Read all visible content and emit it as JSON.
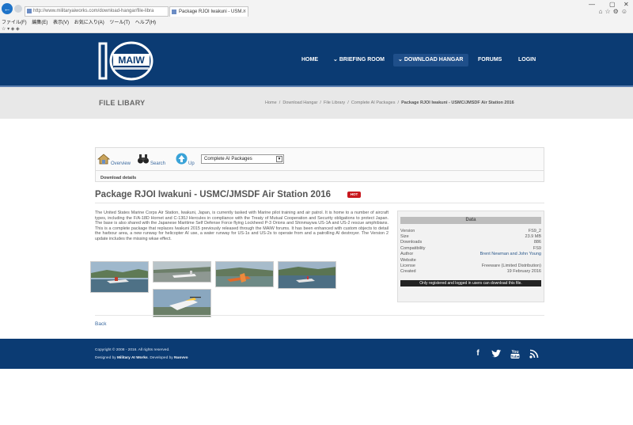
{
  "browser": {
    "url": "http://www.militaryaiworks.com/download-hangar/file-libra",
    "tab_title": "Package RJOI Iwakuni - USM...",
    "menu": [
      "ファイル(F)",
      "編集(E)",
      "表示(V)",
      "お気に入り(A)",
      "ツール(T)",
      "ヘルプ(H)"
    ]
  },
  "site": {
    "nav": [
      {
        "label": "HOME"
      },
      {
        "label": "BRIEFING ROOM",
        "prefix": "⌄"
      },
      {
        "label": "DOWNLOAD HANGAR",
        "prefix": "⌄"
      },
      {
        "label": "FORUMS"
      },
      {
        "label": "LOGIN"
      }
    ]
  },
  "page": {
    "title": "FILE LIBARY",
    "breadcrumb": [
      "Home",
      "Download Hangar",
      "File Library",
      "Complete AI Packages",
      "Package RJOI Iwakuni - USMC/JMSDF Air Station 2016"
    ]
  },
  "toolbar": {
    "overview": "Overview",
    "search": "Search",
    "up": "Up",
    "category_selected": "Complete AI Packages",
    "download_details": "Download details"
  },
  "package": {
    "title": "Package RJOI Iwakuni - USMC/JMSDF Air Station 2016",
    "badge": "HOT",
    "description": "The United States Marine Corps Air Station, Iwakuni, Japan, is currently tasked with Marine pilot training and air patrol. It is home to a number of aircraft types, including the F/A-18D Hornet and C-130J Hercules in compliance with the Treaty of Mutual Cooperation and Security obligations to protect Japan. The base is also shared with the Japanese Maritime Self Defense Force flying Lockheed P-3 Orions and Shinmaywa US-1A and US-2 rescue amphibians. This is a complete package that replaces Iwakuni 2015 previously released through the MAIW forums. It has been enhanced with custom objects to detail the harbour area, a new runway for helicopter AI use, a water runway for US-1s and US-2s to operate from and a patrolling AI destroyer. The Version 2 update includes the missing wkae effect.",
    "back": "Back"
  },
  "data_panel": {
    "heading": "Data",
    "rows": [
      {
        "key": "Version",
        "value": "FS9_2"
      },
      {
        "key": "Size",
        "value": "23.9 MB"
      },
      {
        "key": "Downloads",
        "value": "886"
      },
      {
        "key": "Compatibility",
        "value": "FS9"
      },
      {
        "key": "Author",
        "value": "Brent Newman and John Young"
      },
      {
        "key": "Website",
        "value": ""
      },
      {
        "key": "License",
        "value": "Freeware (Limited Distribution)"
      },
      {
        "key": "Created",
        "value": "19 February 2016"
      }
    ],
    "note": "Only registered and logged in users can download this file."
  },
  "footer": {
    "copyright": "Copyright © 2008 - 2016. All rights reserved.",
    "designed_prefix": "Designed by ",
    "designed_by": "Military AI Works",
    "developed_prefix": ". Developed by ",
    "developed_by": "Nuovvo"
  },
  "colors": {
    "header_blue": "#0b3b73",
    "hot_red": "#c8181e",
    "link_blue": "#3b6aa0"
  }
}
